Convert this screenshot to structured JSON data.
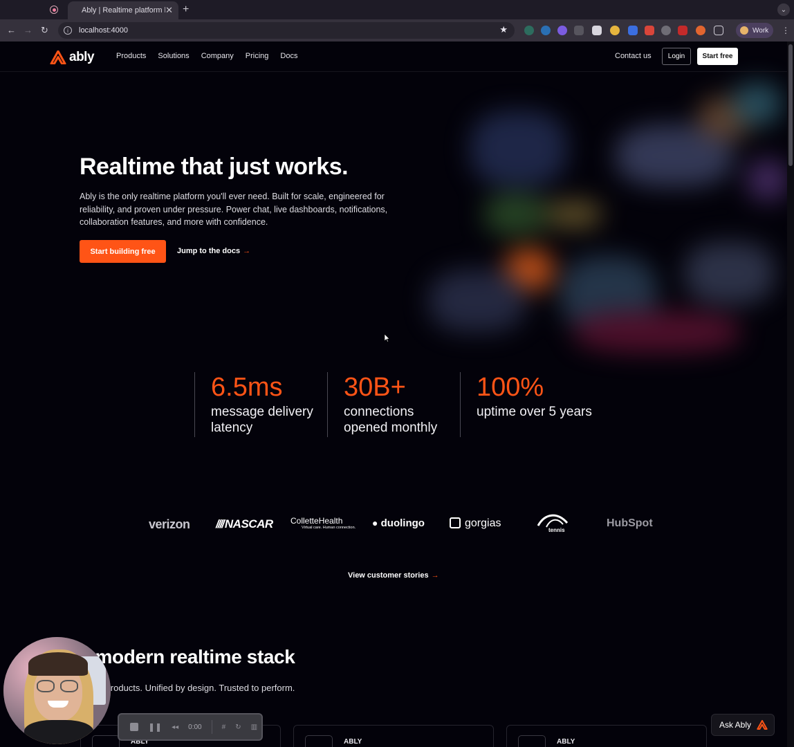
{
  "browser": {
    "tab_title": "Ably | Realtime platform built",
    "url": "localhost:4000",
    "profile_label": "Work"
  },
  "nav": {
    "logo_text": "ably",
    "links": [
      "Products",
      "Solutions",
      "Company",
      "Pricing",
      "Docs"
    ],
    "contact": "Contact us",
    "login": "Login",
    "start_free": "Start free"
  },
  "hero": {
    "title": "Realtime that just works.",
    "subtitle": "Ably is the only realtime platform you'll ever need. Built for scale, engineered for reliability, and proven under pressure. Power chat, live dashboards, notifications, collaboration features, and more with confidence.",
    "cta_primary": "Start building free",
    "cta_secondary": "Jump to the docs",
    "arrow": "→"
  },
  "stats": [
    {
      "value": "6.5ms",
      "label": "message delivery latency"
    },
    {
      "value": "30B+",
      "label": "connections opened monthly"
    },
    {
      "value": "100%",
      "label": "uptime over 5 years"
    }
  ],
  "customers": [
    "verizon",
    "NASCAR",
    "ColletteHealth",
    "duolingo",
    "gorgias",
    "tennis",
    "HubSpot"
  ],
  "customer_tagline": "Virtual care. Human connection.",
  "customer_stories": "View customer stories",
  "stack": {
    "title": "e modern realtime stack",
    "subtitle": "-class products. Unified by design. Trusted to perform.",
    "card_label": "ABLY"
  },
  "ask": "Ask Ably",
  "recorder": {
    "time": "0:00"
  },
  "colors": {
    "accent": "#ff5416",
    "background": "#03020a"
  }
}
